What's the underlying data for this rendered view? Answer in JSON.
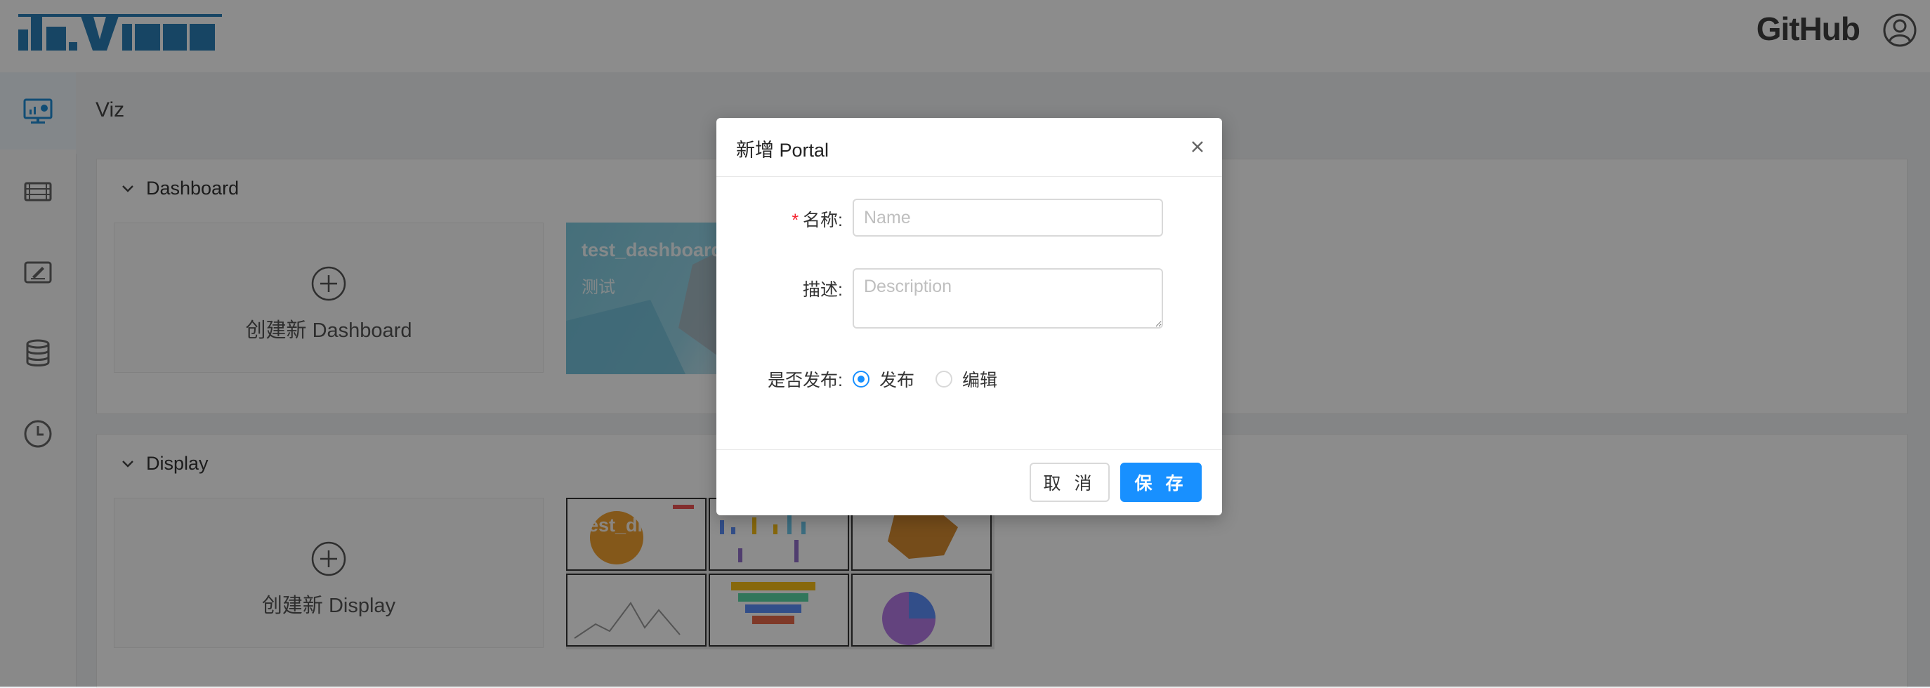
{
  "header": {
    "logo_alt": "davinci",
    "github_label": "GitHub"
  },
  "sidebar": {
    "items": [
      {
        "icon": "dashboard-monitor-icon",
        "active": true
      },
      {
        "icon": "widget-image-icon",
        "active": false
      },
      {
        "icon": "edit-view-icon",
        "active": false
      },
      {
        "icon": "database-icon",
        "active": false
      },
      {
        "icon": "clock-icon",
        "active": false
      }
    ]
  },
  "page": {
    "title": "Viz",
    "dashboard_section": {
      "heading": "Dashboard",
      "create_label": "创建新 Dashboard",
      "items": [
        {
          "name": "test_dashboard",
          "description": "测试"
        }
      ]
    },
    "display_section": {
      "heading": "Display",
      "create_label": "创建新 Display",
      "items": [
        {
          "name": "test_display"
        }
      ]
    }
  },
  "modal": {
    "title": "新增 Portal",
    "fields": {
      "name": {
        "label": "名称:",
        "placeholder": "Name",
        "value": ""
      },
      "description": {
        "label": "描述:",
        "placeholder": "Description",
        "value": ""
      },
      "publish": {
        "label": "是否发布:",
        "options": [
          "发布",
          "编辑"
        ],
        "selected": "发布"
      }
    },
    "cancel_label": "取 消",
    "save_label": "保 存"
  },
  "colors": {
    "primary": "#1890ff",
    "required": "#f5222d",
    "logo": "#1f6fa8"
  }
}
